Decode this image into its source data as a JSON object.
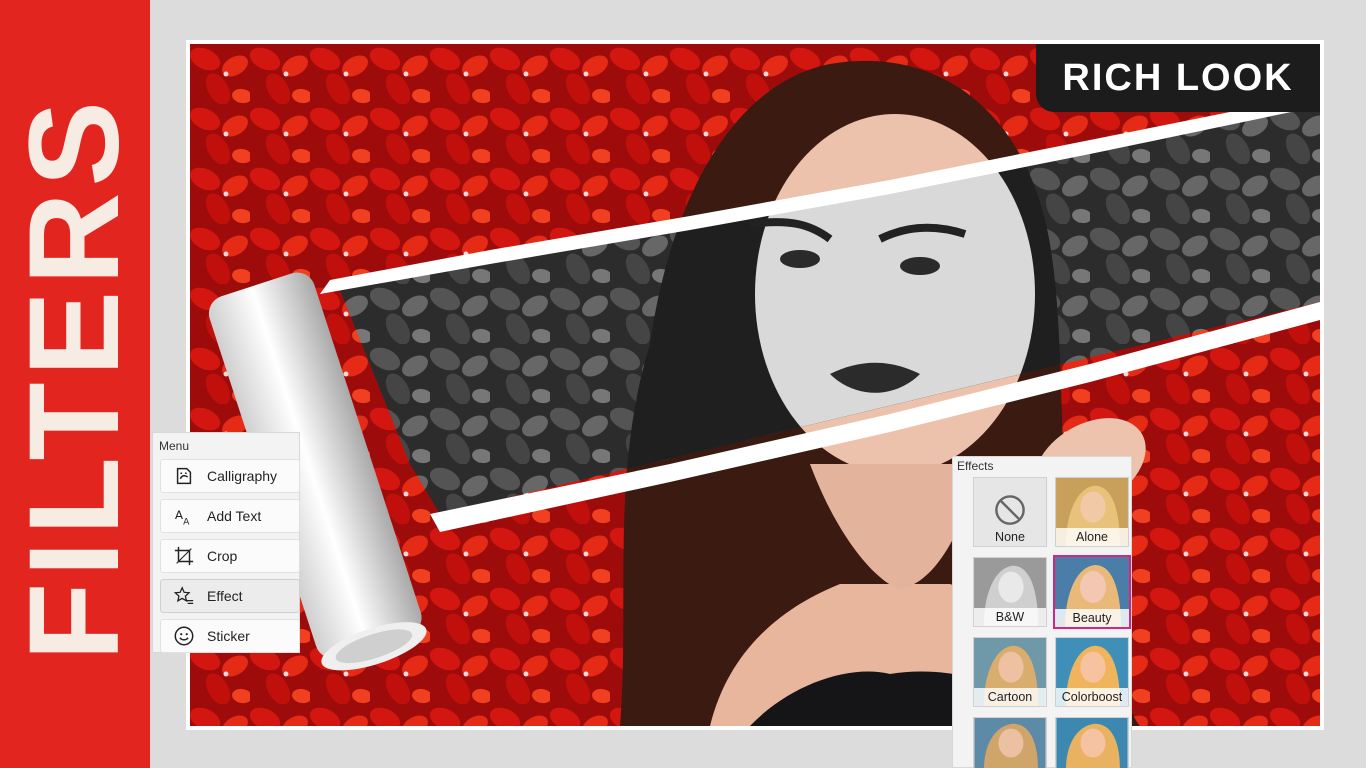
{
  "banner": {
    "title": "FILTERS",
    "color": "#e2261f"
  },
  "badge": {
    "text": "RICH LOOK"
  },
  "menu": {
    "heading": "Menu",
    "items": [
      {
        "label": "Calligraphy",
        "icon": "calligraphy-icon"
      },
      {
        "label": "Add Text",
        "icon": "text-size-icon"
      },
      {
        "label": "Crop",
        "icon": "crop-icon"
      },
      {
        "label": "Effect",
        "icon": "star-effect-icon",
        "selected": true
      },
      {
        "label": "Sticker",
        "icon": "smiley-icon"
      }
    ]
  },
  "effects": {
    "heading": "Effects",
    "tiles": [
      {
        "label": "None",
        "style": "none"
      },
      {
        "label": "Alone",
        "style": "warm"
      },
      {
        "label": "B&W",
        "style": "bw"
      },
      {
        "label": "Beauty",
        "style": "beauty",
        "selected": true
      },
      {
        "label": "Cartoon",
        "style": "cartoon"
      },
      {
        "label": "Colorboost",
        "style": "boost"
      },
      {
        "label": "",
        "style": "cool"
      },
      {
        "label": "",
        "style": "warm"
      }
    ],
    "selected_color": "#d4267f"
  }
}
